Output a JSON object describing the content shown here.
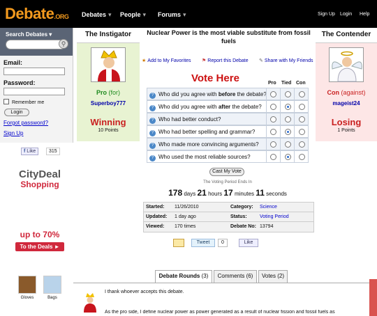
{
  "header": {
    "logo": "Debate",
    "logo_suffix": ".ORG",
    "nav": [
      "Debates",
      "People",
      "Forums"
    ],
    "nav_arrow": "▾",
    "top_links": [
      "Sign Up",
      "Login",
      "Help"
    ]
  },
  "sidebar": {
    "search_label": "Search Debates ▾",
    "email_label": "Email:",
    "password_label": "Password:",
    "remember_label": "Remember me",
    "login_button": "Login",
    "forgot_link": "Forgot password?",
    "signup_link": "Sign Up",
    "like_label": "Like",
    "like_count": "315"
  },
  "ad": {
    "brand_line1": "CityDeal",
    "brand_line2": "Shopping",
    "offer": "up to 70%",
    "cta": "To the Deals ►",
    "items": [
      "Gloves",
      "Bags"
    ]
  },
  "instigator": {
    "heading": "The Instigator",
    "side": "Pro",
    "side_note": "(for)",
    "username": "Superboy777",
    "result": "Winning",
    "points": "10 Points"
  },
  "contender": {
    "heading": "The Contender",
    "side": "Con",
    "side_note": "(against)",
    "username": "mageist24",
    "result": "Losing",
    "points": "1 Points"
  },
  "debate": {
    "title": "Nuclear Power is the most viable substitute from fossil fuels",
    "actions": [
      "Add to My Favorites",
      "Report this Debate",
      "Share with My Friends"
    ]
  },
  "vote": {
    "heading": "Vote Here",
    "columns": [
      "Pro",
      "Tied",
      "Con"
    ],
    "questions": [
      {
        "pre": "Who did you agree with ",
        "bold": "before",
        "post": " the debate?",
        "selected": null
      },
      {
        "pre": "Who did you agree with ",
        "bold": "after",
        "post": " the debate?",
        "selected": "Tied"
      },
      {
        "pre": "Who had better conduct?",
        "bold": "",
        "post": "",
        "selected": null
      },
      {
        "pre": "Who had better spelling and grammar?",
        "bold": "",
        "post": "",
        "selected": "Tied"
      },
      {
        "pre": "Who made more convincing arguments?",
        "bold": "",
        "post": "",
        "selected": null
      },
      {
        "pre": "Who used the most reliable sources?",
        "bold": "",
        "post": "",
        "selected": "Tied"
      }
    ],
    "cast_button": "Cast My Vote",
    "period_label": "The Voting Period Ends In",
    "countdown": {
      "days": "178",
      "days_label": "days",
      "hours": "21",
      "hours_label": "hours",
      "minutes": "17",
      "minutes_label": "minutes",
      "seconds": "11",
      "seconds_label": "seconds"
    }
  },
  "info": {
    "rows": [
      {
        "k1": "Started:",
        "v1": "11/26/2010",
        "k2": "Category:",
        "v2": "Science",
        "link2": true
      },
      {
        "k1": "Updated:",
        "v1": "1 day ago",
        "k2": "Status:",
        "v2": "Voting Period",
        "link2": true
      },
      {
        "k1": "Viewed:",
        "v1": "170 times",
        "k2": "Debate No:",
        "v2": "13794",
        "link2": false
      }
    ]
  },
  "share": {
    "tweet_label": "Tweet",
    "tweet_count": "0",
    "fb_like": "Like"
  },
  "tabs": [
    {
      "label": "Debate Rounds",
      "count": "(3)"
    },
    {
      "label": "Comments",
      "count": "(6)"
    },
    {
      "label": "Votes",
      "count": "(2)"
    }
  ],
  "round": {
    "line1": "I thank whoever accepts this debate.",
    "line2": "As the pro side, I define nuclear power as power generated as a result of nuclear fission and fossil fuels as"
  },
  "colors": {
    "logo": "#f39a1e",
    "win": "#c92020",
    "pro_panel": "#e8f3d2",
    "con_panel": "#fde6e6"
  }
}
